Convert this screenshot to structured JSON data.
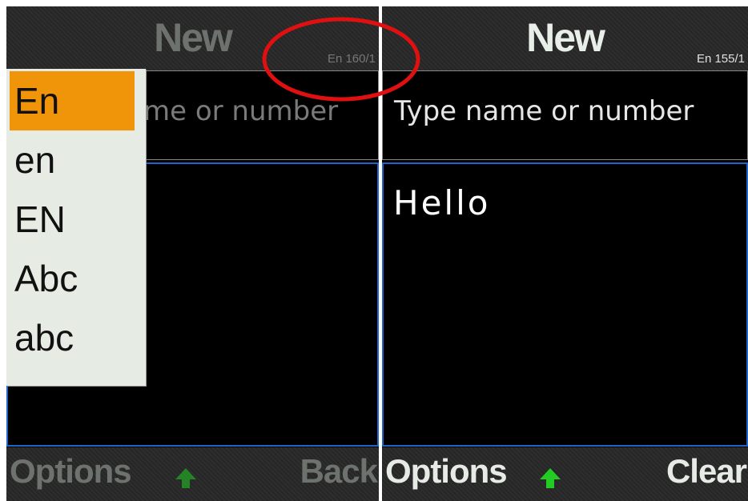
{
  "left_screen": {
    "title": "New",
    "status": "En 160/1",
    "recipient_placeholder": "me or number",
    "softkey_left": "Options",
    "softkey_right": "Back",
    "input_mode_menu": {
      "items": [
        "En",
        "en",
        "EN",
        "Abc",
        "abc"
      ],
      "selected": "En"
    }
  },
  "right_screen": {
    "title": "New",
    "status": "En 155/1",
    "recipient_placeholder": "Type name or number",
    "message_text": "Hello",
    "softkey_left": "Options",
    "softkey_right": "Clear"
  },
  "colors": {
    "accent_selected": "#f0940a",
    "focus_border": "#1f64c8",
    "annotation_ring": "#e01010",
    "softkey_arrow": "#22cc22"
  },
  "icons": [
    "arrow-up-icon"
  ]
}
